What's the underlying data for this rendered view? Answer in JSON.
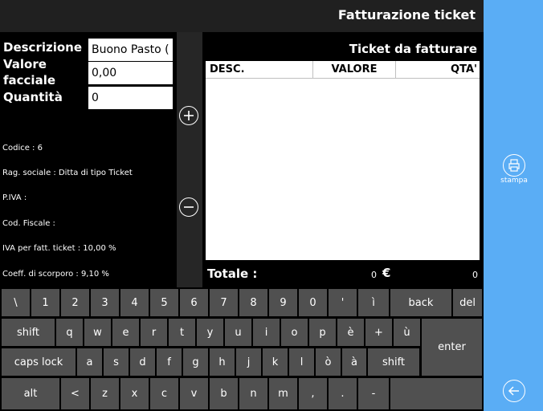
{
  "header": {
    "title": "Fatturazione ticket"
  },
  "form": {
    "descrizione_label": "Descrizione",
    "descrizione_value": "Buono Pasto (",
    "valore_label_1": "Valore",
    "valore_label_2": "facciale",
    "valore_value": "0,00",
    "quantita_label": "Quantità",
    "quantita_value": "0"
  },
  "info": [
    "Codice : 6",
    "Rag. sociale : Ditta di tipo Ticket",
    "P.IVA :",
    "Cod. Fiscale :",
    "IVA per fatt. ticket : 10,00 %",
    "Coeff. di scorporo : 9,10 %"
  ],
  "mid_buttons": {
    "add_icon": "plus-circle-icon",
    "remove_icon": "minus-circle-icon"
  },
  "tickets": {
    "title": "Ticket da fatturare",
    "columns": [
      "DESC.",
      "VALORE",
      "QTA'"
    ],
    "rows": []
  },
  "total": {
    "label": "Totale :",
    "value": "0",
    "currency": "€",
    "qty": "0"
  },
  "keyboard": {
    "row1": [
      "\\",
      "1",
      "2",
      "3",
      "4",
      "5",
      "6",
      "7",
      "8",
      "9",
      "0",
      "'",
      "ì",
      "back",
      "del"
    ],
    "row2": [
      "shift",
      "q",
      "w",
      "e",
      "r",
      "t",
      "y",
      "u",
      "i",
      "o",
      "p",
      "è",
      "+",
      "ù",
      "enter"
    ],
    "row3": [
      "caps lock",
      "a",
      "s",
      "d",
      "f",
      "g",
      "h",
      "j",
      "k",
      "l",
      "ò",
      "à",
      "shift"
    ],
    "row4": [
      "alt",
      "<",
      "z",
      "x",
      "c",
      "v",
      "b",
      "n",
      "m",
      ",",
      ".",
      "-",
      ""
    ]
  },
  "sidebar": {
    "print_label": "stampa",
    "print_icon": "printer-icon",
    "back_icon": "back-arrow-icon"
  },
  "colors": {
    "sidebar": "#5aadf5",
    "topbar": "#202020",
    "key": "#505050"
  }
}
